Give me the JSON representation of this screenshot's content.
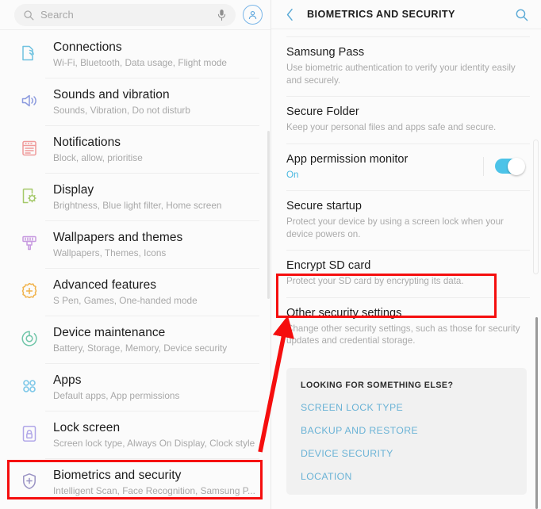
{
  "left": {
    "search": {
      "placeholder": "Search",
      "icon": "search-icon",
      "mic_icon": "microphone-icon"
    },
    "account_icon": "account-avatar-icon",
    "items": [
      {
        "icon": "connections-icon",
        "title": "Connections",
        "subtitle": "Wi-Fi, Bluetooth, Data usage, Flight mode",
        "color": "#6fc2e0"
      },
      {
        "icon": "sounds-vibration-icon",
        "title": "Sounds and vibration",
        "subtitle": "Sounds, Vibration, Do not disturb",
        "color": "#8b9ade"
      },
      {
        "icon": "notifications-icon",
        "title": "Notifications",
        "subtitle": "Block, allow, prioritise",
        "color": "#ef9a9a"
      },
      {
        "icon": "display-icon",
        "title": "Display",
        "subtitle": "Brightness, Blue light filter, Home screen",
        "color": "#a5c96a"
      },
      {
        "icon": "wallpapers-themes-icon",
        "title": "Wallpapers and themes",
        "subtitle": "Wallpapers, Themes, Icons",
        "color": "#c79ae0"
      },
      {
        "icon": "advanced-features-icon",
        "title": "Advanced features",
        "subtitle": "S Pen, Games, One-handed mode",
        "color": "#f0b24a"
      },
      {
        "icon": "device-maintenance-icon",
        "title": "Device maintenance",
        "subtitle": "Battery, Storage, Memory, Device security",
        "color": "#6fc5a8"
      },
      {
        "icon": "apps-icon",
        "title": "Apps",
        "subtitle": "Default apps, App permissions",
        "color": "#7cc7e8"
      },
      {
        "icon": "lock-screen-icon",
        "title": "Lock screen",
        "subtitle": "Screen lock type, Always On Display, Clock style",
        "color": "#b0a6e8"
      },
      {
        "icon": "biometrics-security-icon",
        "title": "Biometrics and security",
        "subtitle": "Intelligent Scan, Face Recognition, Samsung P...",
        "color": "#9a93c4"
      }
    ]
  },
  "right": {
    "header": {
      "back_icon": "back-chevron-icon",
      "title": "BIOMETRICS AND SECURITY",
      "search_icon": "search-icon"
    },
    "items": [
      {
        "title": "Samsung Pass",
        "subtitle": "Use biometric authentication to verify your identity easily and securely."
      },
      {
        "title": "Secure Folder",
        "subtitle": "Keep your personal files and apps safe and secure."
      },
      {
        "title": "App permission monitor",
        "status": "On",
        "toggle": true,
        "toggle_color": "#4cc3e8"
      },
      {
        "title": "Secure startup",
        "subtitle": "Protect your device by using a screen lock when your device powers on."
      },
      {
        "title": "Encrypt SD card",
        "subtitle": "Protect your SD card by encrypting its data."
      },
      {
        "title": "Other security settings",
        "subtitle": "Change other security settings, such as those for security updates and credential storage."
      }
    ],
    "looking_card": {
      "heading": "LOOKING FOR SOMETHING ELSE?",
      "links": [
        "SCREEN LOCK TYPE",
        "BACKUP AND RESTORE",
        "DEVICE SECURITY",
        "LOCATION"
      ]
    }
  },
  "annotations": {
    "color": "#f50e0e",
    "highlight_encrypt_sd_card": true,
    "highlight_biometrics_and_security": true,
    "arrow_from": "biometrics-and-security-row",
    "arrow_to": "encrypt-sd-card-row"
  }
}
